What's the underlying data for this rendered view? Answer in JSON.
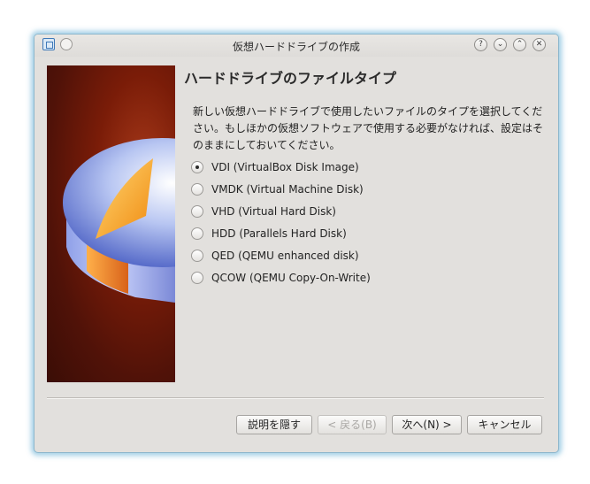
{
  "window": {
    "title": "仮想ハードドライブの作成",
    "buttons": {
      "help": "?",
      "minimize": "⌄",
      "maximize": "⌃",
      "close": "✕"
    }
  },
  "page": {
    "heading": "ハードドライブのファイルタイプ",
    "description": "新しい仮想ハードドライブで使用したいファイルのタイプを選択してください。もしほかの仮想ソフトウェアで使用する必要がなければ、設定はそのままにしておいてください。",
    "options": [
      {
        "label": "VDI (VirtualBox Disk Image)",
        "checked": true
      },
      {
        "label": "VMDK (Virtual Machine Disk)",
        "checked": false
      },
      {
        "label": "VHD (Virtual Hard Disk)",
        "checked": false
      },
      {
        "label": "HDD (Parallels Hard Disk)",
        "checked": false
      },
      {
        "label": "QED (QEMU enhanced disk)",
        "checked": false
      },
      {
        "label": "QCOW (QEMU Copy-On-Write)",
        "checked": false
      }
    ]
  },
  "buttons": {
    "hide_description": "説明を隠す",
    "back": "< 戻る(B)",
    "next": "次へ(N) >",
    "cancel": "キャンセル"
  }
}
